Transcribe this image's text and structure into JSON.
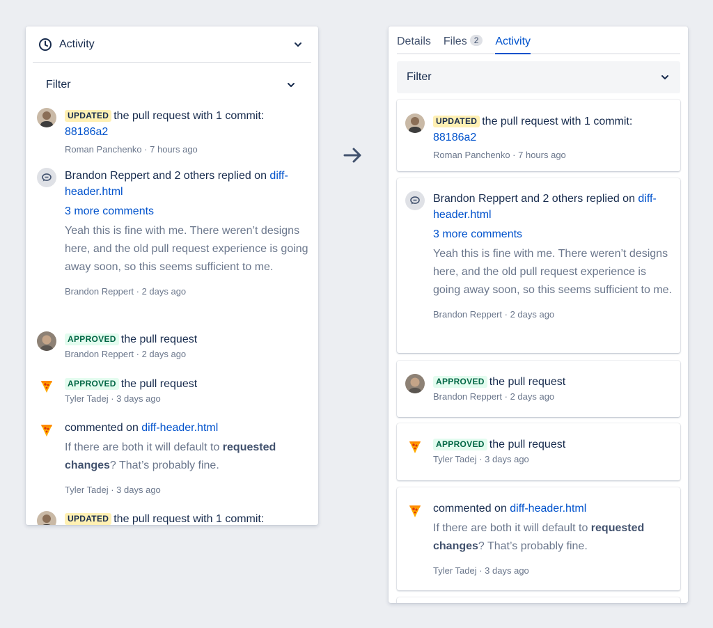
{
  "left": {
    "header_title": "Activity",
    "filter_label": "Filter",
    "entries": [
      {
        "badge": "UPDATED",
        "text": "the pull request with 1 commit:",
        "link": "88186a2",
        "meta": "Roman Panchenko · 7 hours ago"
      },
      {
        "text": "Brandon Reppert and 2 others replied on ",
        "link": "diff-header.html",
        "more": "3 more comments",
        "comment": "Yeah this is fine with me. There weren’t designs here, and the old pull request experience is going away soon, so this seems sufficient to me.",
        "meta": "Brandon Reppert · 2 days ago"
      },
      {
        "badge": "APPROVED",
        "text": "the pull request",
        "meta": "Brandon Reppert · 2 days ago"
      },
      {
        "badge": "APPROVED",
        "text": "the pull request",
        "meta": "Tyler Tadej · 3 days ago"
      },
      {
        "text": "commented on ",
        "link": "diff-header.html",
        "comment_pre": "If there are both it will default to ",
        "comment_bold": "requested changes",
        "comment_post": "? That’s probably fine.",
        "meta": "Tyler Tadej · 3 days ago"
      },
      {
        "badge": "UPDATED",
        "text": "the pull request with 1 commit:"
      }
    ]
  },
  "right": {
    "tabs": [
      {
        "label": "Details"
      },
      {
        "label": "Files",
        "count": "2"
      },
      {
        "label": "Activity"
      }
    ],
    "filter_label": "Filter",
    "entries": [
      {
        "badge": "UPDATED",
        "text": "the pull request with 1 commit:",
        "link": "88186a2",
        "meta": "Roman Panchenko · 7 hours ago"
      },
      {
        "text": "Brandon Reppert and 2 others replied on ",
        "link": "diff-header.html",
        "more": "3 more comments",
        "comment": "Yeah this is fine with me. There weren’t designs here, and the old pull request experience is going away soon, so this seems sufficient to me.",
        "meta": "Brandon Reppert · 2 days ago"
      },
      {
        "badge": "APPROVED",
        "text": "the pull request",
        "meta": "Brandon Reppert · 2 days ago"
      },
      {
        "badge": "APPROVED",
        "text": "the pull request",
        "meta": "Tyler Tadej · 3 days ago"
      },
      {
        "text": "commented on ",
        "link": "diff-header.html",
        "comment_pre": "If there are both it will default to ",
        "comment_bold": "requested changes",
        "comment_post": "? That’s probably fine.",
        "meta": "Tyler Tadej · 3 days ago"
      }
    ]
  },
  "icons": {
    "clock": "clock-icon",
    "chevron": "chevron-down-icon",
    "comment": "comment-icon",
    "arrow": "arrow-right-icon",
    "pizza": "pizza-avatar-icon"
  },
  "colors": {
    "link": "#0052cc",
    "updated_bg": "#fff0b3",
    "approved_bg": "#e3fcef",
    "approved_text": "#006644",
    "background": "#eceef2"
  }
}
